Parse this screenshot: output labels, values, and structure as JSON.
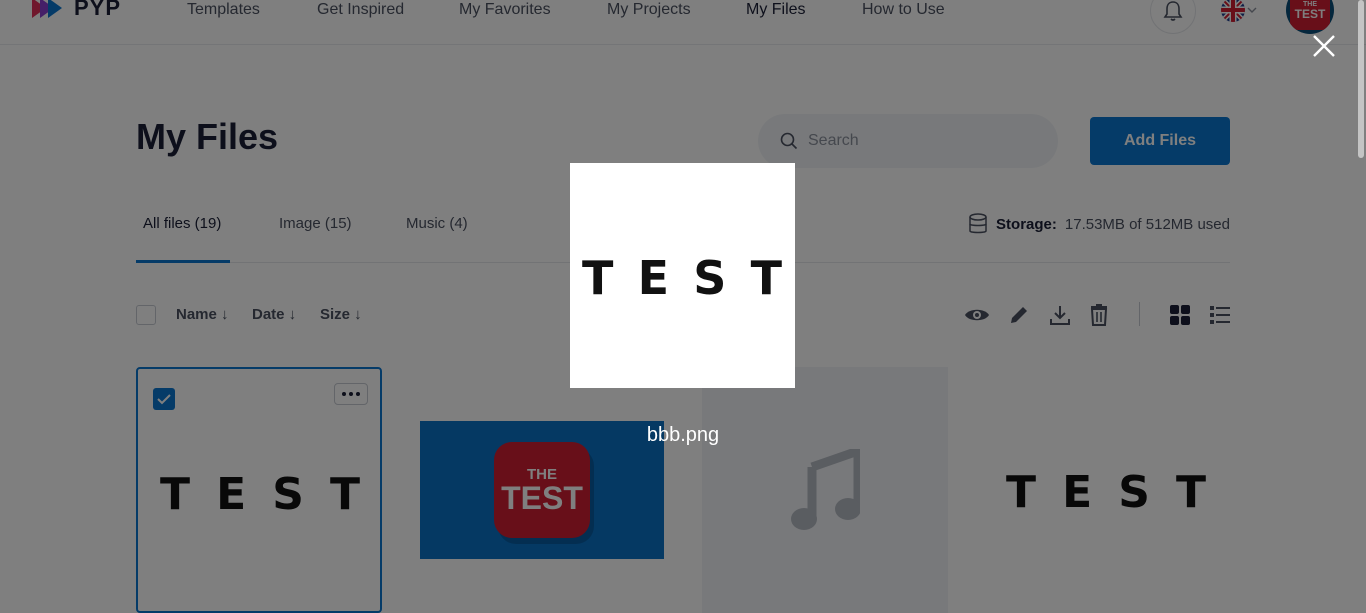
{
  "app": {
    "logo_text": "PYP"
  },
  "nav": {
    "items": [
      {
        "label": "Templates"
      },
      {
        "label": "Get Inspired"
      },
      {
        "label": "My Favorites"
      },
      {
        "label": "My Projects"
      },
      {
        "label": "My Files"
      },
      {
        "label": "How to Use"
      }
    ],
    "active": "My Files",
    "avatar_text_top": "THE",
    "avatar_text_bottom": "TEST"
  },
  "page": {
    "title": "My Files",
    "search_placeholder": "Search",
    "add_button": "Add Files"
  },
  "tabs": [
    {
      "label": "All files (19)"
    },
    {
      "label": "Image (15)"
    },
    {
      "label": "Music (4)"
    }
  ],
  "storage": {
    "label": "Storage:",
    "value": "17.53MB of 512MB used"
  },
  "sort": {
    "name": "Name ↓",
    "date": "Date ↓",
    "size": "Size ↓"
  },
  "cards": [
    {
      "kind": "image",
      "text": "TEST",
      "selected": true
    },
    {
      "kind": "image",
      "badge_top": "THE",
      "badge_bottom": "TEST"
    },
    {
      "kind": "music"
    },
    {
      "kind": "image",
      "text": "TEST"
    }
  ],
  "preview": {
    "text": "TEST",
    "filename": "bbb.png"
  },
  "colors": {
    "accent": "#0a77d1",
    "brand_red": "#d11f32",
    "overlay": "rgba(0,0,0,0.5)"
  }
}
